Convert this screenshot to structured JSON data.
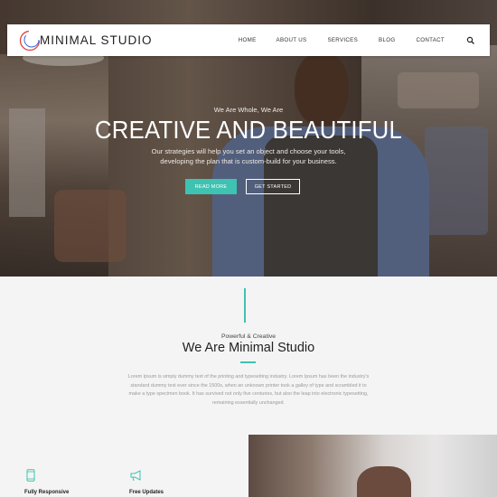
{
  "brand": {
    "name": "MINIMAL STUDIO",
    "accent": "#3ec2b2",
    "logo_accent": "#e0423b"
  },
  "nav": {
    "items": [
      "HOME",
      "ABOUT US",
      "SERVICES",
      "BLOG",
      "CONTACT"
    ],
    "search_icon": "search-icon"
  },
  "hero": {
    "subtitle": "We Are Whole, We Are",
    "title": "CREATIVE AND BEAUTIFUL",
    "description": "Our strategies will help you set an object and choose your tools, developing the plan that is custom-build for your business.",
    "primary_button": "READ MORE",
    "secondary_button": "GET STARTED"
  },
  "about": {
    "kicker": "Powerful & Creative",
    "title": "We Are Minimal Studio",
    "body": "Lorem Ipsum is simply dummy text of the printing and typesetting industry. Lorem Ipsum has been the industry's standard dummy text ever since the 1500s, when an unknown printer took a galley of type and scrambled it to make a type specimen book. It has survived not only five centuries, but also the leap into electronic typesetting, remaining essentially unchanged."
  },
  "features": [
    {
      "icon": "tablet-icon",
      "label": "Fully Responsive"
    },
    {
      "icon": "megaphone-icon",
      "label": "Free Updates"
    }
  ]
}
